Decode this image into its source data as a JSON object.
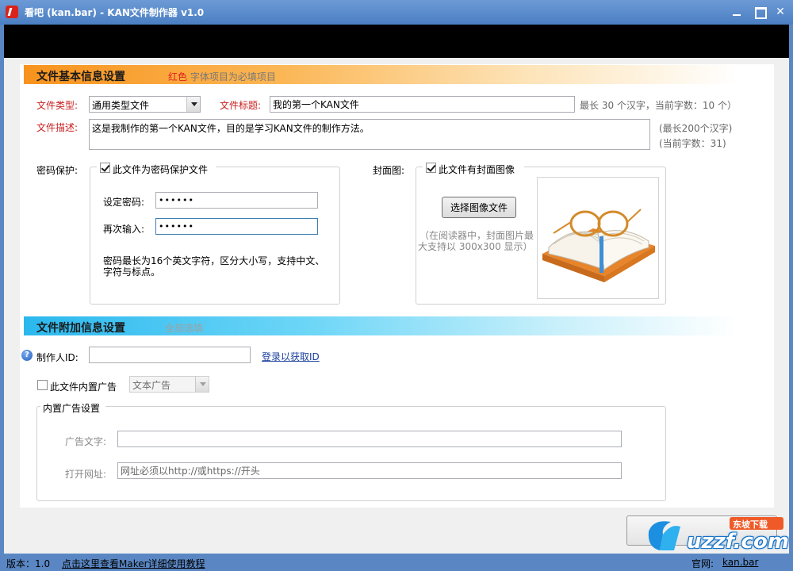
{
  "window": {
    "title": "看吧 (kan.bar) - KAN文件制作器 v1.0",
    "minimize": "—",
    "maximize": "□",
    "close": "✕"
  },
  "section_basic": {
    "title": "文件基本信息设置",
    "note_red": "红色",
    "note_rest": "字体项目为必填项目"
  },
  "file_type": {
    "label": "文件类型:",
    "value": "通用类型文件"
  },
  "file_title": {
    "label": "文件标题:",
    "value": "我的第一个KAN文件",
    "hint": "最长 30 个汉字，当前字数：10 个）"
  },
  "file_desc": {
    "label": "文件描述:",
    "value": "这是我制作的第一个KAN文件，目的是学习KAN文件的制作方法。",
    "hint_max": "(最长200个汉字)",
    "hint_count": "(当前字数：31)"
  },
  "password": {
    "label": "密码保护:",
    "checkbox_label": "此文件为密码保护文件",
    "checked": true,
    "set_label": "设定密码:",
    "set_value": "••••••",
    "repeat_label": "再次输入:",
    "repeat_value": "••••••",
    "note_line1": "密码最长为16个英文字符，区分大小写，支持中文、",
    "note_line2": "字符与标点。"
  },
  "cover": {
    "label": "封面图:",
    "checkbox_label": "此文件有封面图像",
    "checked": true,
    "select_button": "选择图像文件",
    "note_line1": "（在阅读器中，封面图片最",
    "note_line2": "大支持以 300x300 显示）",
    "image_icon": "open-book-with-glasses-icon"
  },
  "section_extra": {
    "title": "文件附加信息设置",
    "note": "全部选填"
  },
  "maker_id": {
    "help_icon": "help-icon",
    "label": "制作人ID:",
    "value": "",
    "link": "登录以获取ID"
  },
  "ad": {
    "checkbox_label": "此文件内置广告",
    "checked": false,
    "type_value": "文本广告",
    "group_title": "内置广告设置",
    "text_label": "广告文字:",
    "text_value": "",
    "url_label": "打开网址:",
    "url_placeholder": "网址必须以http://或https://开头"
  },
  "status": {
    "version": "版本：1.0",
    "help_link": "点击这里查看Maker详细使用教程",
    "site_label": "官网:",
    "site_link": "kan.bar"
  },
  "watermark": {
    "text": "uzzf.com",
    "badge": "东坡下载"
  },
  "colors": {
    "section_basic_accent": "#f7931e",
    "section_extra_accent": "#2bb8ee",
    "required_red": "#c81e1e",
    "titlebar": "#5a87c4"
  }
}
